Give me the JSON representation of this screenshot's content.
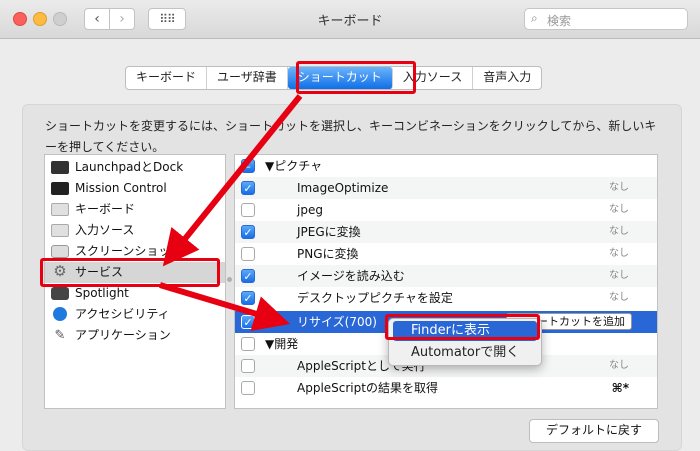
{
  "window": {
    "title": "キーボード",
    "search_placeholder": "検索",
    "back": "‹",
    "forward": "›",
    "grid": "⠿⠿"
  },
  "tabs": [
    {
      "label": "キーボード",
      "selected": false
    },
    {
      "label": "ユーザ辞書",
      "selected": false
    },
    {
      "label": "ショートカット",
      "selected": true
    },
    {
      "label": "入力ソース",
      "selected": false
    },
    {
      "label": "音声入力",
      "selected": false
    }
  ],
  "description": "ショートカットを変更するには、ショートカットを選択し、キーコンビネーションをクリックしてから、新しいキーを押してください。",
  "categories": [
    {
      "label": "LaunchpadとDock",
      "icon": "launchpad-icon"
    },
    {
      "label": "Mission Control",
      "icon": "mission-control-icon"
    },
    {
      "label": "キーボード",
      "icon": "keyboard-icon"
    },
    {
      "label": "入力ソース",
      "icon": "input-source-icon"
    },
    {
      "label": "スクリーンショット",
      "icon": "screenshot-icon"
    },
    {
      "label": "サービス",
      "icon": "gear-icon",
      "selected": true
    },
    {
      "label": "Spotlight",
      "icon": "spotlight-icon"
    },
    {
      "label": "アクセシビリティ",
      "icon": "accessibility-icon"
    },
    {
      "label": "アプリケーション",
      "icon": "app-shortcuts-icon"
    }
  ],
  "services": {
    "group_picture": "▼ピクチャ",
    "group_dev": "▼開発",
    "items": [
      {
        "label": "ImageOptimize",
        "checked": true,
        "key": "なし"
      },
      {
        "label": "jpeg",
        "checked": false,
        "key": "なし"
      },
      {
        "label": "JPEGに変換",
        "checked": true,
        "key": "なし"
      },
      {
        "label": "PNGに変換",
        "checked": false,
        "key": "なし"
      },
      {
        "label": "イメージを読み込む",
        "checked": true,
        "key": "なし"
      },
      {
        "label": "デスクトップピクチャを設定",
        "checked": true,
        "key": "なし"
      },
      {
        "label": "リサイズ(700)",
        "checked": true,
        "key": "",
        "selected": true
      },
      {
        "label": "AppleScriptとして実行",
        "checked": false,
        "key": "なし"
      },
      {
        "label": "AppleScriptの結果を取得",
        "checked": false,
        "key": "⌘*"
      }
    ],
    "add_shortcut_label": "ートカットを追加"
  },
  "context_menu": {
    "items": [
      "Finderに表示",
      "Automatorで開く"
    ],
    "highlighted": 0
  },
  "default_button": "デフォルトに戻す",
  "colors": {
    "accent": "#2a67d6",
    "annotation": "#e60012"
  }
}
